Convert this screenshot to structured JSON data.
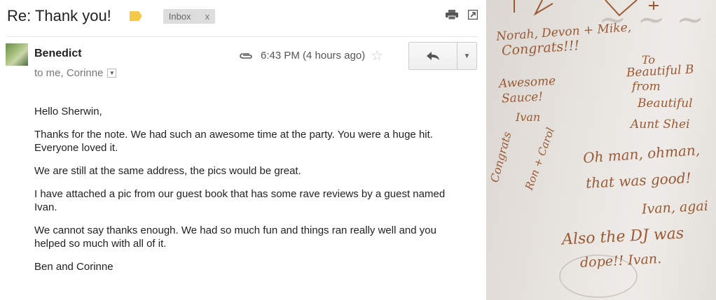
{
  "email": {
    "subject": "Re: Thank you!",
    "inbox_chip": "Inbox",
    "inbox_chip_close": "x",
    "sender": "Benedict",
    "recipients": "to me, Corinne",
    "time": "6:43 PM (4 hours ago)",
    "body": [
      "Hello Sherwin,",
      "Thanks for the note. We had such an awesome time at the party. You were a huge hit. Everyone loved it.",
      "We are still at the same address, the pics would be great.",
      "I have attached a pic from our guest book that has some rave reviews by a guest named Ivan.",
      "We cannot say thanks enough. We had so much fun and things ran really well and you helped so much with all of it.",
      "Ben and Corinne"
    ],
    "icons": {
      "label": "label-tag-icon",
      "print": "print-icon",
      "popout": "popout-icon",
      "attachment": "paperclip-icon",
      "star": "star-icon",
      "reply": "reply-icon",
      "more": "dropdown-icon"
    }
  },
  "photo": {
    "notes": [
      "Norah, Devon + Mike,",
      "Congrats!!!",
      "Awesome",
      "Sauce!",
      "Ivan",
      "To",
      "Beautiful B",
      "from",
      "Beautiful",
      "Aunt Shei",
      "Oh man, ohman,",
      "that was good!",
      "Ivan, agai",
      "Also the DJ was",
      "dope!! Ivan.",
      "Congrats",
      "Ron + Carol"
    ]
  }
}
